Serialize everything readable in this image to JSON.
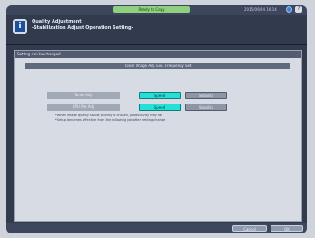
{
  "header": {
    "status_text": "Ready to Copy",
    "datetime": "2015/09/24 16:14",
    "help_label": "?",
    "title_line1": "Quality Adjustment",
    "title_line2": "-Stabilization Adjust Operation Setting-"
  },
  "panel": {
    "header": "Setting can be changed",
    "subheader": "Toner Image Adj. Exe. Frequency Set",
    "rows": [
      {
        "label": "Toner Adj.",
        "option_speed": "Speed",
        "option_stability": "Stability",
        "selected": "Speed"
      },
      {
        "label": "CPU Pre Adj.",
        "option_speed": "Speed",
        "option_stability": "Stability",
        "selected": "Speed"
      }
    ],
    "notes": [
      "*When image quality stable priority is chosen, productivity may fall",
      "*Setup becomes effective from the following job after setting change"
    ]
  },
  "footer": {
    "cancel_label": "Cancel",
    "ok_label": "OK"
  },
  "colors": {
    "selected": "#23e1d6",
    "status_green": "#8fd07e",
    "background": "#323a4e"
  }
}
